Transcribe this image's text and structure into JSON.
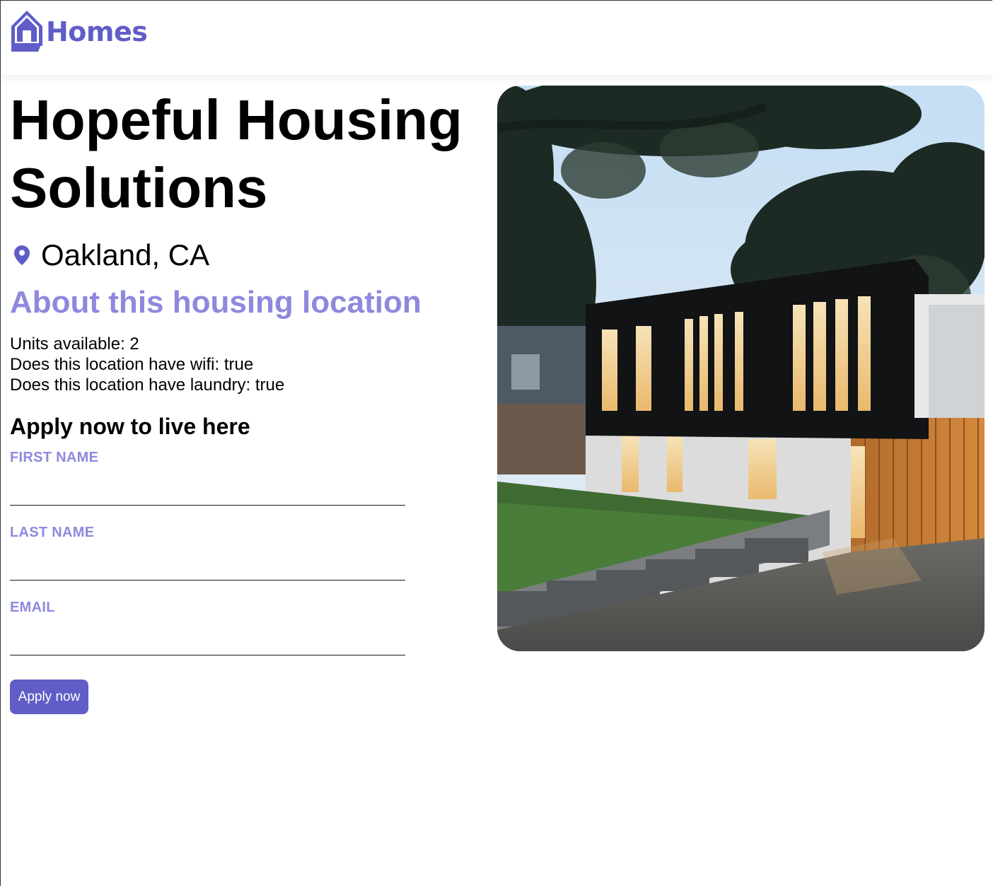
{
  "header": {
    "brand_name": "Homes",
    "brand_icon": "house-logo-icon",
    "accent_color": "#605dc8"
  },
  "listing": {
    "name": "Hopeful Housing Solutions",
    "location": "Oakland, CA",
    "location_icon": "map-pin-icon",
    "photo_icon": "house-photo"
  },
  "about": {
    "heading": "About this housing location",
    "units_line": "Units available: 2",
    "wifi_line": "Does this location have wifi: true",
    "laundry_line": "Does this location have laundry: true",
    "heading_color": "#8d89de"
  },
  "form": {
    "heading": "Apply now to live here",
    "first_name_label": "FIRST NAME",
    "first_name_value": "",
    "last_name_label": "LAST NAME",
    "last_name_value": "",
    "email_label": "EMAIL",
    "email_value": "",
    "submit_label": "Apply now"
  }
}
